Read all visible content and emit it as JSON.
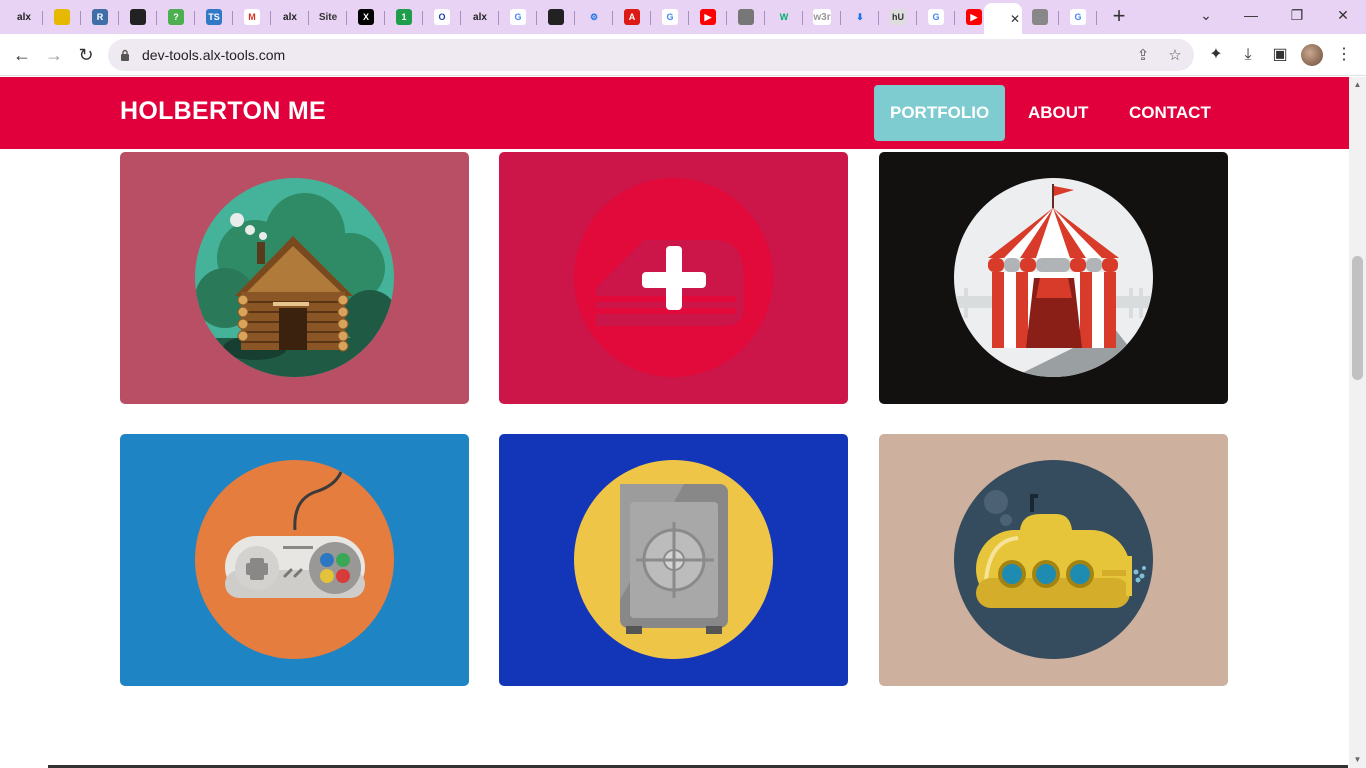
{
  "browser": {
    "tabs": [
      {
        "icon": "alx-icon",
        "text": "alx",
        "bg": "transparent",
        "fg": "#222"
      },
      {
        "icon": "chrome-icon",
        "text": "",
        "bg": "#e7b800",
        "fg": "#fff"
      },
      {
        "icon": "r-icon",
        "text": "R",
        "bg": "#3f6ea8",
        "fg": "#fff"
      },
      {
        "icon": "github-icon",
        "text": "",
        "bg": "#222",
        "fg": "#fff"
      },
      {
        "icon": "help-icon",
        "text": "?",
        "bg": "#4caf50",
        "fg": "#fff"
      },
      {
        "icon": "ts-icon",
        "text": "TS",
        "bg": "#3178c6",
        "fg": "#fff"
      },
      {
        "icon": "gmail-icon",
        "text": "M",
        "bg": "#fff",
        "fg": "#d93025"
      },
      {
        "icon": "alx-icon",
        "text": "alx",
        "bg": "transparent",
        "fg": "#222"
      },
      {
        "icon": "site-icon",
        "text": "Site",
        "bg": "transparent",
        "fg": "#333"
      },
      {
        "icon": "x-icon",
        "text": "X",
        "bg": "#000",
        "fg": "#fff"
      },
      {
        "icon": "one-icon",
        "text": "1",
        "bg": "#1e9e4a",
        "fg": "#fff"
      },
      {
        "icon": "ring-icon",
        "text": "O",
        "bg": "#fff",
        "fg": "#1c3fa8"
      },
      {
        "icon": "alx-icon",
        "text": "alx",
        "bg": "transparent",
        "fg": "#222"
      },
      {
        "icon": "google-icon",
        "text": "G",
        "bg": "#fff",
        "fg": "#4285f4"
      },
      {
        "icon": "github-icon",
        "text": "",
        "bg": "#222",
        "fg": "#fff"
      },
      {
        "icon": "gear-icon",
        "text": "⚙",
        "bg": "transparent",
        "fg": "#1a73e8"
      },
      {
        "icon": "angular-icon",
        "text": "A",
        "bg": "#dd1b16",
        "fg": "#fff"
      },
      {
        "icon": "google-icon",
        "text": "G",
        "bg": "#fff",
        "fg": "#4285f4"
      },
      {
        "icon": "youtube-icon",
        "text": "▶",
        "bg": "#ff0000",
        "fg": "#fff"
      },
      {
        "icon": "globe-icon",
        "text": "",
        "bg": "#777",
        "fg": "#fff"
      },
      {
        "icon": "w3-icon",
        "text": "W",
        "bg": "transparent",
        "fg": "#04aa6d"
      },
      {
        "icon": "w3r-icon",
        "text": "w3r",
        "bg": "#fff",
        "fg": "#999"
      },
      {
        "icon": "download-icon",
        "text": "⬇",
        "bg": "transparent",
        "fg": "#1a73e8"
      },
      {
        "icon": "hu-icon",
        "text": "hU",
        "bg": "#ddd",
        "fg": "#333"
      },
      {
        "icon": "google-icon",
        "text": "G",
        "bg": "#fff",
        "fg": "#4285f4"
      },
      {
        "icon": "youtube-icon",
        "text": "▶",
        "bg": "#ff0000",
        "fg": "#fff"
      },
      {
        "icon": "active-page-icon",
        "text": "",
        "bg": "transparent",
        "fg": "#333"
      },
      {
        "icon": "chrome-icon",
        "text": "",
        "bg": "#888",
        "fg": "#fff"
      },
      {
        "icon": "google-icon",
        "text": "G",
        "bg": "#fff",
        "fg": "#4285f4"
      }
    ],
    "active_tab_index": 26,
    "url": "dev-tools.alx-tools.com"
  },
  "site": {
    "title": "HOLBERTON ME",
    "nav": [
      {
        "label": "PORTFOLIO",
        "active": true
      },
      {
        "label": "ABOUT",
        "active": false
      },
      {
        "label": "CONTACT",
        "active": false
      }
    ],
    "colors": {
      "header": "#e1003c",
      "active_nav": "#7ecbd0"
    }
  },
  "portfolio": [
    {
      "name": "cabin",
      "icon": "log-cabin-icon",
      "card_color": "#b84f64",
      "circle_color": "#45b39a"
    },
    {
      "name": "plus",
      "icon": "plus-icon",
      "card_color": "#cc1548",
      "circle_color": "#e2093b"
    },
    {
      "name": "circus",
      "icon": "circus-tent-icon",
      "card_color": "#131110",
      "circle_color": "#eceeef"
    },
    {
      "name": "game",
      "icon": "game-controller-icon",
      "card_color": "#1e84c4",
      "circle_color": "#e47d3e"
    },
    {
      "name": "safe",
      "icon": "safe-icon",
      "card_color": "#1335b8",
      "circle_color": "#eec546"
    },
    {
      "name": "submarine",
      "icon": "submarine-icon",
      "card_color": "#cdb09e",
      "circle_color": "#344c5e"
    }
  ]
}
